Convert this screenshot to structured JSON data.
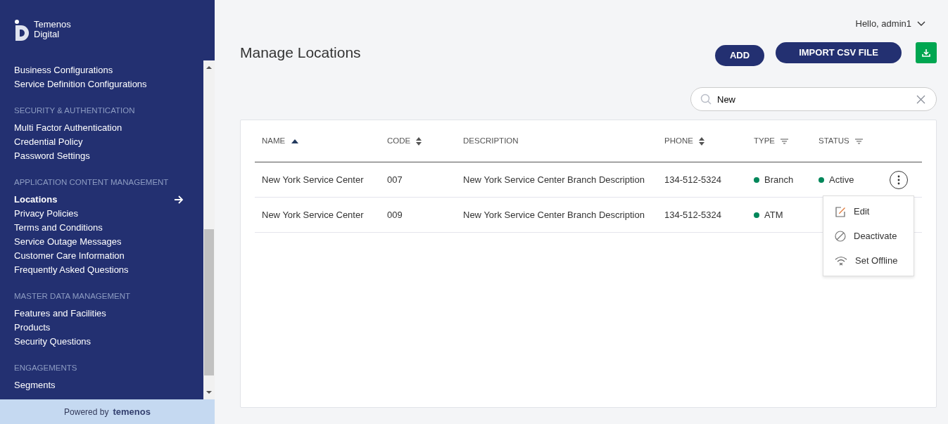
{
  "sidebar": {
    "logo": {
      "line1": "Temenos",
      "line2": "Digital"
    },
    "groups": [
      {
        "items": [
          {
            "label": "Business Configurations",
            "selected": false
          },
          {
            "label": "Service Definition Configurations",
            "selected": false
          }
        ]
      },
      {
        "heading": "SECURITY & AUTHENTICATION",
        "items": [
          {
            "label": "Multi Factor Authentication",
            "selected": false
          },
          {
            "label": "Credential Policy",
            "selected": false
          },
          {
            "label": "Password Settings",
            "selected": false
          }
        ]
      },
      {
        "heading": "APPLICATION CONTENT MANAGEMENT",
        "items": [
          {
            "label": "Locations",
            "selected": true
          },
          {
            "label": "Privacy Policies",
            "selected": false
          },
          {
            "label": "Terms and Conditions",
            "selected": false
          },
          {
            "label": "Service Outage Messages",
            "selected": false
          },
          {
            "label": "Customer Care Information",
            "selected": false
          },
          {
            "label": "Frequently Asked Questions",
            "selected": false
          }
        ]
      },
      {
        "heading": "MASTER DATA MANAGEMENT",
        "items": [
          {
            "label": "Features and Facilities",
            "selected": false
          },
          {
            "label": "Products",
            "selected": false
          },
          {
            "label": "Security Questions",
            "selected": false
          }
        ]
      },
      {
        "heading": "ENGAGEMENTS",
        "items": [
          {
            "label": "Segments",
            "selected": false
          }
        ]
      }
    ],
    "footer": {
      "prefix": "Powered by",
      "brand": "temenos"
    }
  },
  "user_menu": {
    "greeting": "Hello, admin1"
  },
  "page_title": "Manage Locations",
  "buttons": [
    "ADD",
    "IMPORT CSV FILE"
  ],
  "search": {
    "value": "New"
  },
  "table": {
    "columns": [
      {
        "label": "NAME",
        "sorted_ascending": true,
        "sortable": false,
        "filterable": false
      },
      {
        "label": "CODE",
        "sorted_ascending": false,
        "sortable": true,
        "filterable": false
      },
      {
        "label": "DESCRIPTION",
        "sorted_ascending": false,
        "sortable": false,
        "filterable": false
      },
      {
        "label": "PHONE",
        "sorted_ascending": false,
        "sortable": true,
        "filterable": false
      },
      {
        "label": "TYPE",
        "sorted_ascending": false,
        "sortable": false,
        "filterable": true
      },
      {
        "label": "STATUS",
        "sorted_ascending": false,
        "sortable": false,
        "filterable": true
      }
    ],
    "rows": [
      {
        "name": "New York Service Center",
        "code": "007",
        "description": "New York Service Center Branch Description",
        "phone": "134-512-5324",
        "type": "Branch",
        "status": "Active",
        "menu_open": true
      },
      {
        "name": "New York Service Center",
        "code": "009",
        "description": "New York Service Center Branch Description",
        "phone": "134-512-5324",
        "type": "ATM",
        "menu_open": false
      }
    ]
  },
  "row_menu": [
    {
      "kind": "edit",
      "label": "Edit"
    },
    {
      "kind": "deactivate",
      "label": "Deactivate"
    },
    {
      "kind": "offline",
      "label": "Set Offline"
    }
  ]
}
